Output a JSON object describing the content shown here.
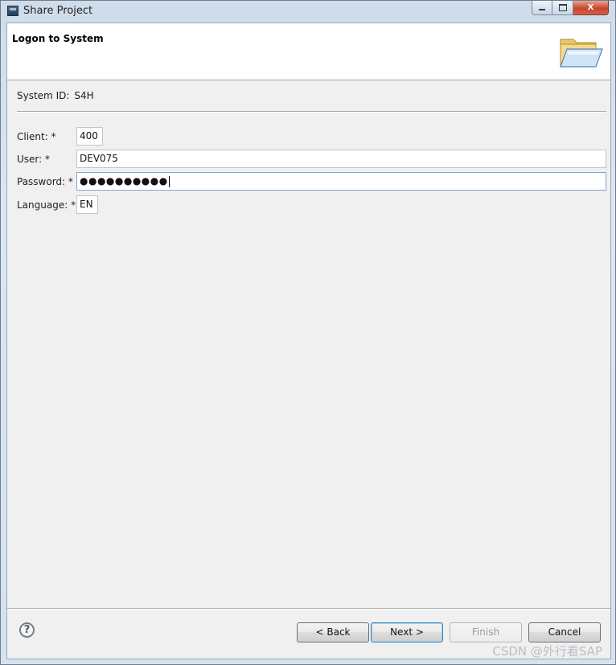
{
  "window": {
    "title": "Share Project",
    "close_label": "X"
  },
  "banner": {
    "title": "Logon to System",
    "icon": "open-folder-icon"
  },
  "system": {
    "label": "System ID:",
    "value": "S4H"
  },
  "form": {
    "client_label": "Client: *",
    "client_value": "400",
    "user_label": "User: *",
    "user_value": "DEV075",
    "password_label": "Password: *",
    "password_value": "●●●●●●●●●●",
    "language_label": "Language: *",
    "language_value": "EN"
  },
  "buttons": {
    "help": "?",
    "back": "< Back",
    "next": "Next >",
    "finish": "Finish",
    "cancel": "Cancel"
  },
  "watermark": "CSDN @外行看SAP",
  "colors": {
    "default_button_border": "#3c7fb1",
    "focused_field_border": "#86a6c9"
  }
}
